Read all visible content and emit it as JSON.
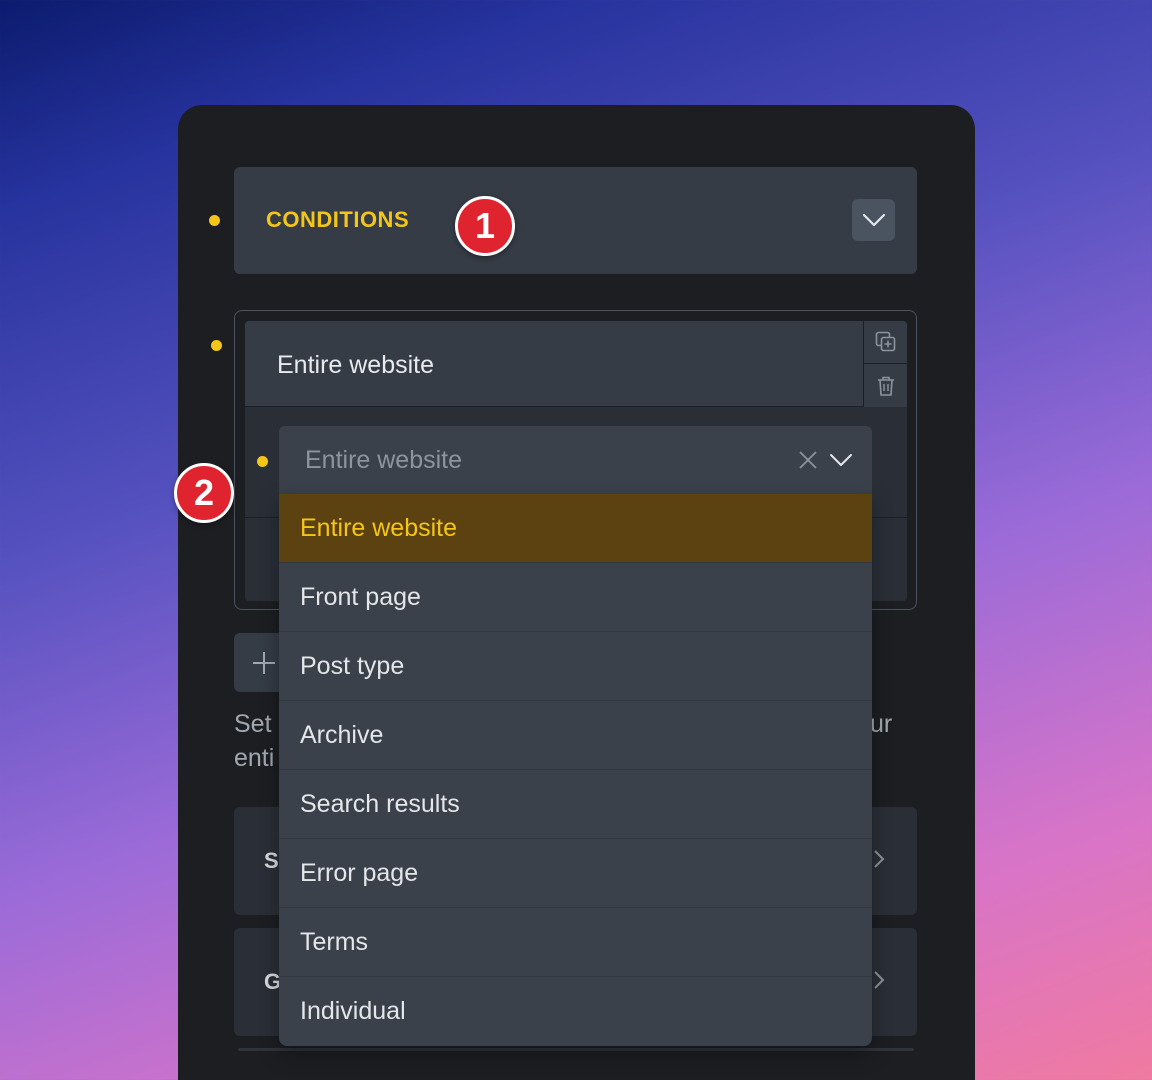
{
  "colors": {
    "accent": "#f5c518",
    "badge": "#e0242f",
    "panel": "#1c1e22",
    "selected_bg": "#5b4210"
  },
  "header": {
    "title": "CONDITIONS",
    "toggle_icon": "chevron-down-icon"
  },
  "annotations": {
    "badge_1": "1",
    "badge_2": "2"
  },
  "rule": {
    "label": "Entire website",
    "duplicate_icon": "duplicate-icon",
    "delete_icon": "trash-icon"
  },
  "select": {
    "value": "Entire website",
    "clear_icon": "close-icon",
    "toggle_icon": "chevron-down-icon",
    "options": [
      "Entire website",
      "Front page",
      "Post type",
      "Archive",
      "Search results",
      "Error page",
      "Terms",
      "Individual"
    ],
    "selected_index": 0
  },
  "add_button": {
    "icon": "plus-icon"
  },
  "description": {
    "line1_visible": "Set",
    "line2_visible": "enti",
    "tail_visible": "ur"
  },
  "sections": [
    {
      "label_visible": "S",
      "icon": "chevron-right-icon"
    },
    {
      "label_visible": "G",
      "icon": "chevron-right-icon"
    }
  ]
}
